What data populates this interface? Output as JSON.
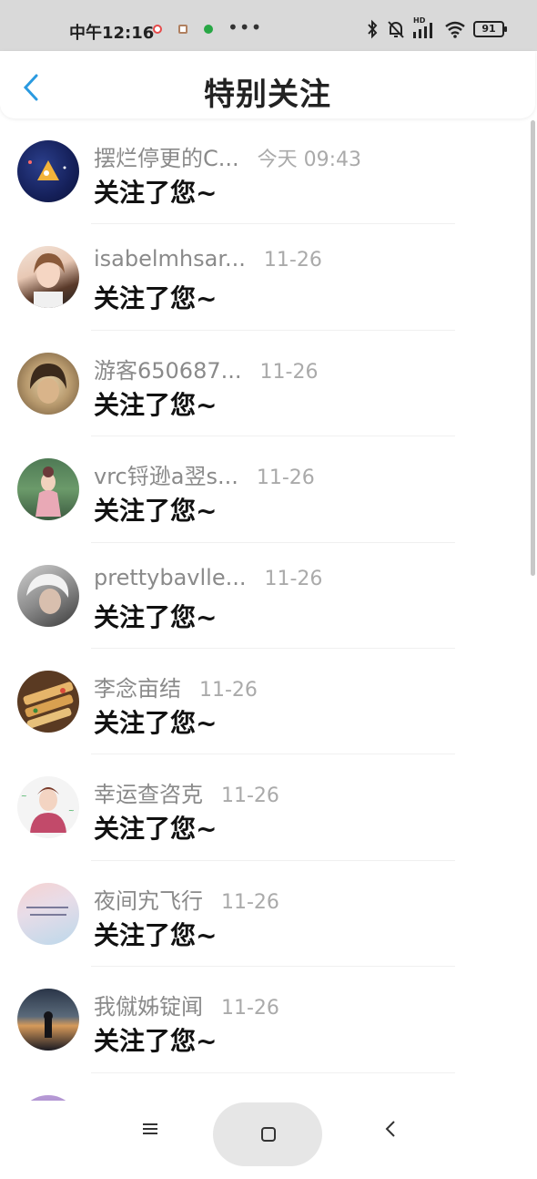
{
  "status_bar": {
    "time": "中午12:16",
    "dots": "•••",
    "hd": "HD",
    "battery": "91",
    "app_icon_colors": [
      "#e64a4a",
      "#b08060",
      "#28a745"
    ]
  },
  "header": {
    "title": "特别关注",
    "back_icon": "chevron-left-icon",
    "accent": "#2a9ae0"
  },
  "list": {
    "items": [
      {
        "name": "摆烂停更的C...",
        "date": "今天 09:43",
        "message": "关注了您~",
        "avatar": "galaxy"
      },
      {
        "name": "isabelmhsar...",
        "date": "11-26",
        "message": "关注了您~",
        "avatar": "girl"
      },
      {
        "name": "游客650687...",
        "date": "11-26",
        "message": "关注了您~",
        "avatar": "sepia-portrait"
      },
      {
        "name": "vrc锊逊a翌s...",
        "date": "11-26",
        "message": "关注了您~",
        "avatar": "outdoor-girl"
      },
      {
        "name": "prettybavlle...",
        "date": "11-26",
        "message": "关注了您~",
        "avatar": "white-hair"
      },
      {
        "name": "李念亩结",
        "date": "11-26",
        "message": "关注了您~",
        "avatar": "food"
      },
      {
        "name": "幸运查咨克",
        "date": "11-26",
        "message": "关注了您~",
        "avatar": "pink-girl"
      },
      {
        "name": "夜间宄飞行",
        "date": "11-26",
        "message": "关注了您~",
        "avatar": "pastel-text"
      },
      {
        "name": "我僦姊锭闻",
        "date": "11-26",
        "message": "关注了您~",
        "avatar": "sunset"
      },
      {
        "name": "",
        "date": "",
        "message": "",
        "avatar": "purple"
      }
    ]
  },
  "nav_bar": {
    "menu_icon": "menu-icon",
    "home_icon": "home-square-icon",
    "back_icon": "back-triangle-icon"
  }
}
